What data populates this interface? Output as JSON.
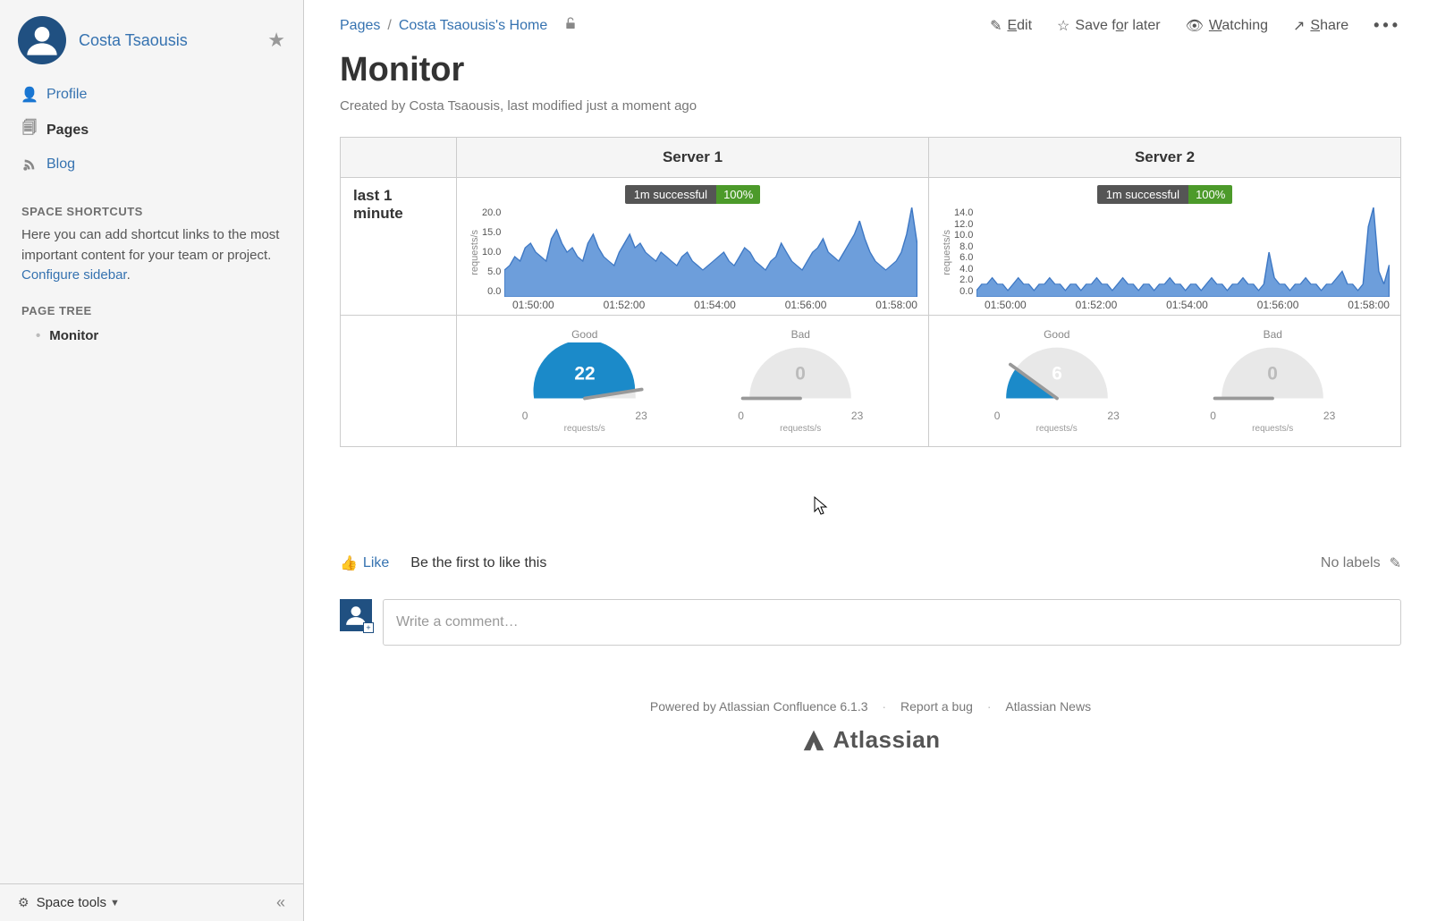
{
  "sidebar": {
    "space_name": "Costa Tsaousis",
    "nav": {
      "profile": "Profile",
      "pages": "Pages",
      "blog": "Blog"
    },
    "shortcuts_heading": "SPACE SHORTCUTS",
    "shortcuts_text": "Here you can add shortcut links to the most important content for your team or project. ",
    "configure_link": "Configure sidebar",
    "page_tree_heading": "PAGE TREE",
    "page_tree_item": "Monitor",
    "footer_label": "Space tools"
  },
  "breadcrumbs": {
    "root": "Pages",
    "home": "Costa Tsaousis's Home"
  },
  "actions": {
    "edit": "Edit",
    "save": "Save for later",
    "watching": "Watching",
    "share": "Share"
  },
  "page": {
    "title": "Monitor",
    "byline": "Created by Costa Tsaousis, last modified just a moment ago",
    "row_label": "last 1 minute"
  },
  "servers": [
    "Server 1",
    "Server 2"
  ],
  "like": {
    "link": "Like",
    "prompt": "Be the first to like this",
    "no_labels": "No labels"
  },
  "comment": {
    "placeholder": "Write a comment…"
  },
  "footer": {
    "powered": "Powered by Atlassian Confluence 6.1.3",
    "bug": "Report a bug",
    "news": "Atlassian News",
    "brand": "Atlassian"
  },
  "chart_data": [
    {
      "type": "area",
      "title": "Server 1 — 1m successful 100%",
      "badge": {
        "text": "1m successful",
        "pct": "100%"
      },
      "ylabel": "requests/s",
      "yticks": [
        0,
        5,
        10,
        15,
        20
      ],
      "ylim": [
        0,
        20
      ],
      "xticks": [
        "01:50:00",
        "01:52:00",
        "01:54:00",
        "01:56:00",
        "01:58:00"
      ],
      "values": [
        6,
        7,
        9,
        8,
        11,
        12,
        10,
        9,
        8,
        13,
        15,
        12,
        10,
        11,
        9,
        8,
        12,
        14,
        11,
        9,
        8,
        7,
        10,
        12,
        14,
        11,
        12,
        10,
        9,
        8,
        10,
        9,
        8,
        7,
        9,
        10,
        8,
        7,
        6,
        7,
        8,
        9,
        10,
        8,
        7,
        9,
        11,
        10,
        8,
        7,
        6,
        8,
        9,
        12,
        10,
        8,
        7,
        6,
        8,
        10,
        11,
        13,
        10,
        9,
        8,
        10,
        12,
        14,
        17,
        13,
        10,
        8,
        7,
        6,
        7,
        8,
        10,
        14,
        20,
        12
      ],
      "gauges": [
        {
          "label": "Good",
          "value": 22,
          "min": 0,
          "max": 23,
          "unit": "requests/s",
          "fill": 0.95
        },
        {
          "label": "Bad",
          "value": 0,
          "min": 0,
          "max": 23,
          "unit": "requests/s",
          "fill": 0.0
        }
      ]
    },
    {
      "type": "area",
      "title": "Server 2 — 1m successful 100%",
      "badge": {
        "text": "1m successful",
        "pct": "100%"
      },
      "ylabel": "requests/s",
      "yticks": [
        0,
        2,
        4,
        6,
        8,
        10,
        12,
        14
      ],
      "ylim": [
        0,
        14
      ],
      "xticks": [
        "01:50:00",
        "01:52:00",
        "01:54:00",
        "01:56:00",
        "01:58:00"
      ],
      "values": [
        1,
        2,
        2,
        3,
        2,
        2,
        1,
        2,
        3,
        2,
        2,
        1,
        2,
        2,
        3,
        2,
        2,
        1,
        2,
        2,
        1,
        2,
        2,
        3,
        2,
        2,
        1,
        2,
        3,
        2,
        2,
        1,
        2,
        2,
        1,
        2,
        2,
        3,
        2,
        2,
        1,
        2,
        2,
        1,
        2,
        3,
        2,
        2,
        1,
        2,
        2,
        3,
        2,
        2,
        1,
        2,
        7,
        3,
        2,
        2,
        1,
        2,
        2,
        3,
        2,
        2,
        1,
        2,
        2,
        3,
        4,
        2,
        2,
        1,
        2,
        11,
        14,
        4,
        2,
        5
      ],
      "gauges": [
        {
          "label": "Good",
          "value": 6,
          "min": 0,
          "max": 23,
          "unit": "requests/s",
          "fill": 0.2
        },
        {
          "label": "Bad",
          "value": 0,
          "min": 0,
          "max": 23,
          "unit": "requests/s",
          "fill": 0.0
        }
      ]
    }
  ]
}
